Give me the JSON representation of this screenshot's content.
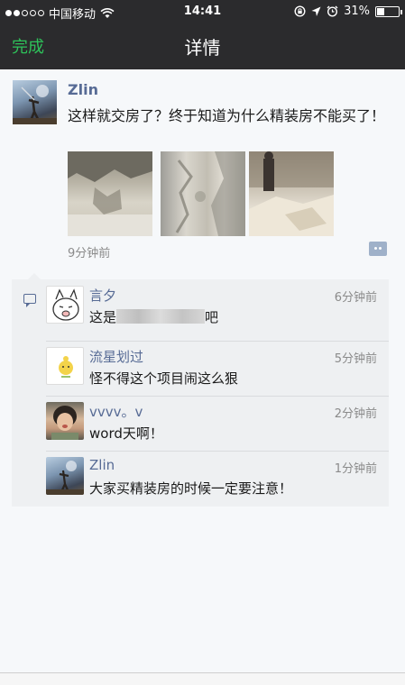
{
  "status_bar": {
    "carrier": "中国移动",
    "time": "14:41",
    "battery": "31%"
  },
  "nav": {
    "done_label": "完成",
    "title": "详情"
  },
  "post": {
    "author": "Zlin",
    "text": "这样就交房了？终于知道为什么精装房不能买了！",
    "time": "9分钟前"
  },
  "comments": [
    {
      "author": "言夕",
      "prefix": "这是",
      "suffix": "吧",
      "time": "6分钟前"
    },
    {
      "author": "流星划过",
      "text": "怪不得这个项目闹这么狠",
      "time": "5分钟前"
    },
    {
      "author": "vvvv。v",
      "text": "word天啊！",
      "time": "2分钟前"
    },
    {
      "author": "Zlin",
      "text": "大家买精装房的时候一定要注意！",
      "time": "1分钟前"
    }
  ],
  "colors": {
    "accent_green": "#2ec25a",
    "name_blue": "#576b95",
    "nav_bg": "#2b2b2d"
  }
}
